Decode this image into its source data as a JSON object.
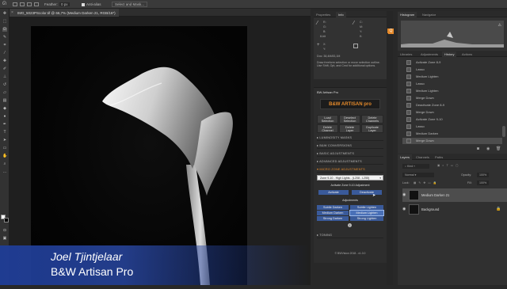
{
  "options_bar": {
    "feather": "Feather:",
    "feather_value": "0 px",
    "anti_alias": "Anti-alias",
    "select_and_mask": "Select and Mask..."
  },
  "document_tab": {
    "title": "IMG_5023PScolor.tif @ 66,7% (Medium Darken 21, RGB/16*)"
  },
  "info_panel": {
    "tabs": [
      "Properties",
      "Info"
    ],
    "r_label": "R:",
    "g_label": "G:",
    "b_label": "B:",
    "bit_label": "8-bit",
    "x_label": "X:",
    "y_label": "Y:",
    "doc_label": "Doc: 38,4M/83,1M",
    "hint": "Draw freeform selection or move selection outline. Use Shift, Opt, and Cmd for additional options."
  },
  "artisan_panel": {
    "title": "BW Artisan Pro",
    "logo_text": "B&W ARTISAN pro",
    "buttons": [
      {
        "line1": "Load",
        "line2": "Selection"
      },
      {
        "line1": "Deselect",
        "line2": "Selection"
      },
      {
        "line1": "Delete",
        "line2": "Channels"
      },
      {
        "line1": "Delete",
        "line2": "Channel"
      },
      {
        "line1": "Delete",
        "line2": "Layer"
      },
      {
        "line1": "Duplicate",
        "line2": "Layer"
      }
    ],
    "sections": {
      "luminosity_masks": "▸ LUMINOSITY MASKS",
      "bw_conversions": "▸ B&W CONVERSIONS",
      "basic_adjustments": "▸ BASIC ADJUSTMENTS",
      "advanced_adjustments": "▸ ADVANCED ADJUSTMENTS",
      "micro_zone": "▾ MICRO ZONE ADJUSTMENTS",
      "toning": "▸ TONING"
    },
    "zone_select": "Zone 9-10 - High Lights - (L208 - L255)",
    "activate_label": "Activate Zone 9-10 Adjustment",
    "activate_button": "Activate",
    "deactivate_button": "Deactivate",
    "adjustments_label": "Adjustments",
    "adjustment_buttons": [
      "Subtle Darken",
      "Subtle Lighten",
      "Medium Darken",
      "Medium Lighten",
      "Strong Darken",
      "Strong Lighten"
    ],
    "footer": "© BWVision 2018 - v1.0.0"
  },
  "histogram_panel": {
    "tabs": [
      "Histogram",
      "Navigator"
    ]
  },
  "history_panel": {
    "tabs": [
      "Libraries",
      "Adjustments",
      "History",
      "Actions"
    ],
    "items": [
      "Activate Zone 8-9",
      "Lasso",
      "Medium Lighten",
      "Lasso",
      "Medium Lighten",
      "Merge Down",
      "Deactivate Zone 8-9",
      "Merge Down",
      "Activate Zone 9-10",
      "Lasso",
      "Medium Darken",
      "Merge Down"
    ],
    "selected_index": 11
  },
  "layers_panel": {
    "tabs": [
      "Layers",
      "Channels",
      "Paths"
    ],
    "kind_label": "Kind",
    "blend_mode": "Normal",
    "opacity_label": "Opacity:",
    "opacity_value": "100%",
    "lock_label": "Lock:",
    "fill_label": "Fill:",
    "fill_value": "100%",
    "layers": [
      {
        "name": "Medium Darken 21",
        "selected": true
      },
      {
        "name": "Background",
        "selected": false
      }
    ]
  },
  "caption": {
    "name": "Joel Tjintjelaar",
    "product": "B&W Artisan Pro"
  },
  "colors": {
    "accent_orange": "#e58a2b",
    "caption_blue": "#2a4aa8",
    "zone_button_blue": "#3a5a9a"
  }
}
